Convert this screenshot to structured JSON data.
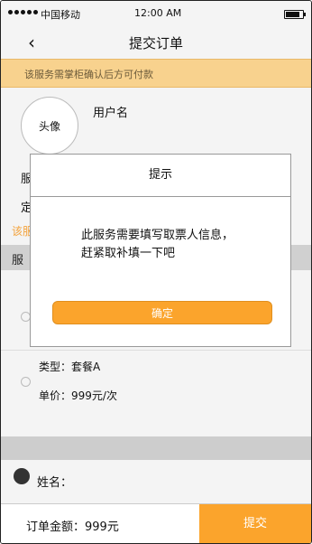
{
  "status_bar": {
    "carrier": "中国移动",
    "time": "12:00 AM"
  },
  "nav": {
    "back_icon": "‹",
    "title": "提交订单"
  },
  "notice": "该服务需掌柜确认后方可付款",
  "user": {
    "avatar_label": "头像",
    "username": "用户名"
  },
  "partial": {
    "line1": "服",
    "line2": "定",
    "line3": "该服",
    "section": "服"
  },
  "package": {
    "type_text": "类型：套餐A",
    "price_text": "单价：999元/次"
  },
  "form": {
    "name_label": "姓名："
  },
  "bottom": {
    "total": "订单金额：999元",
    "submit": "提交"
  },
  "modal": {
    "title": "提示",
    "message": "此服务需要填写取票人信息，赶紧取补填一下吧",
    "confirm": "确定"
  },
  "colors": {
    "accent": "#fba42c",
    "notice_bg": "#f8d28e"
  }
}
